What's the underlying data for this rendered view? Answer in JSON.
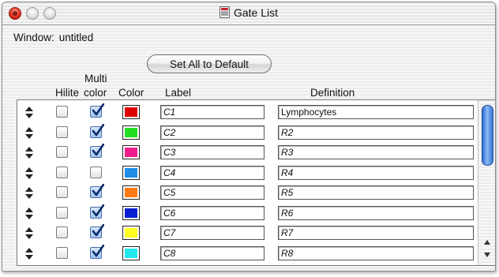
{
  "window": {
    "title": "Gate List"
  },
  "info": {
    "window_label": "Window:",
    "window_value": "untitled"
  },
  "toolbar": {
    "set_default_label": "Set All to Default"
  },
  "headers": {
    "hilite": "Hilite",
    "multi_top": "Multi",
    "multi_bottom": "color",
    "color": "Color",
    "label": "Label",
    "definition": "Definition"
  },
  "rows": [
    {
      "label": "C1",
      "definition": "Lymphocytes",
      "hilite": false,
      "multicolor": true,
      "color": "#dd0000"
    },
    {
      "label": "C2",
      "definition": "R2",
      "hilite": false,
      "multicolor": true,
      "color": "#22dd22"
    },
    {
      "label": "C3",
      "definition": "R3",
      "hilite": false,
      "multicolor": true,
      "color": "#ee1c8c"
    },
    {
      "label": "C4",
      "definition": "R4",
      "hilite": false,
      "multicolor": false,
      "color": "#1e8ee8"
    },
    {
      "label": "C5",
      "definition": "R5",
      "hilite": false,
      "multicolor": true,
      "color": "#ff7a12"
    },
    {
      "label": "C6",
      "definition": "R6",
      "hilite": false,
      "multicolor": true,
      "color": "#0a1ed2"
    },
    {
      "label": "C7",
      "definition": "R7",
      "hilite": false,
      "multicolor": true,
      "color": "#ffff22"
    },
    {
      "label": "C8",
      "definition": "R8",
      "hilite": false,
      "multicolor": true,
      "color": "#22e8ee"
    }
  ],
  "icons": {
    "close": "close-button",
    "minimize": "minimize-button",
    "zoom": "zoom-button",
    "document": "document-icon",
    "reorder": "up-down-arrow-icon",
    "check": "checkmark-icon"
  },
  "colors": {
    "accent": "#3a78d8",
    "window_bg": "#ececec"
  }
}
